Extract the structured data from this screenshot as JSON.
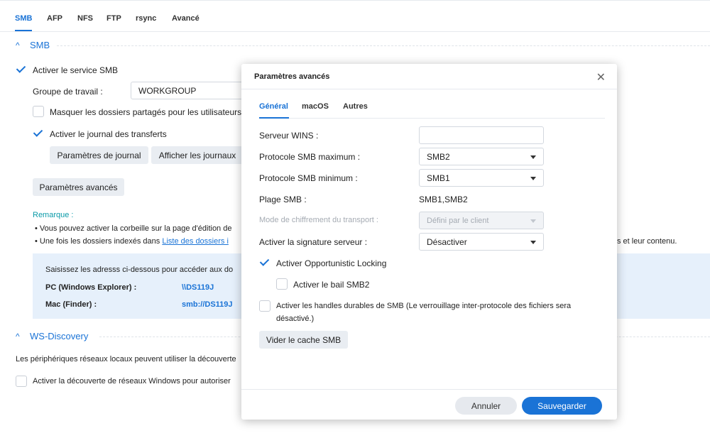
{
  "tabs": [
    {
      "label": "SMB",
      "active": true
    },
    {
      "label": "AFP"
    },
    {
      "label": "NFS"
    },
    {
      "label": "FTP"
    },
    {
      "label": "rsync"
    },
    {
      "label": "Avancé"
    }
  ],
  "smb_section": {
    "title": "SMB",
    "enable_label": "Activer le service SMB",
    "workgroup_label": "Groupe de travail :",
    "workgroup_value": "WORKGROUP",
    "hide_shares_label": "Masquer les dossiers partagés pour les utilisateurs ne",
    "transfer_log_label": "Activer le journal des transferts",
    "log_settings_button": "Paramètres de journal",
    "view_logs_button": "Afficher les journaux",
    "advanced_button": "Paramètres avancés",
    "note_title": "Remarque :",
    "note_1": "Vous pouvez activer la corbeille sur la page d'édition de",
    "note_2_prefix": "Une fois les dossiers indexés dans ",
    "note_2_link": "Liste des dossiers i",
    "note_2_tail": "s et leur contenu.",
    "info_intro": "Saisissez les adresss ci-dessous pour accéder aux do",
    "pc_label": "PC (Windows Explorer) :",
    "pc_value": "\\\\DS119J",
    "mac_label": "Mac (Finder) :",
    "mac_value": "smb://DS119J"
  },
  "ws_section": {
    "title": "WS-Discovery",
    "description": "Les périphériques réseaux locaux peuvent utiliser la découverte",
    "enable_label": "Activer la découverte de réseaux Windows pour autoriser"
  },
  "modal": {
    "title": "Paramètres avancés",
    "close_glyph": "✕",
    "tabs": [
      {
        "label": "Général",
        "active": true
      },
      {
        "label": "macOS"
      },
      {
        "label": "Autres"
      }
    ],
    "wins_label": "Serveur WINS :",
    "wins_value": "",
    "max_protocol_label": "Protocole SMB maximum :",
    "max_protocol_value": "SMB2",
    "min_protocol_label": "Protocole SMB minimum :",
    "min_protocol_value": "SMB1",
    "range_label": "Plage SMB :",
    "range_value": "SMB1,SMB2",
    "encryption_label": "Mode de chiffrement du transport :",
    "encryption_value": "Défini par le client",
    "signing_label": "Activer la signature serveur :",
    "signing_value": "Désactiver",
    "oplock_label": "Activer Opportunistic Locking",
    "lease_label": "Activer le bail SMB2",
    "durable_label_1": "Activer les handles durables de SMB (Le verrouillage inter-protocole des fichiers sera",
    "durable_label_2": "désactivé.)",
    "clear_cache_button": "Vider le cache SMB",
    "cancel_button": "Annuler",
    "save_button": "Sauvegarder"
  },
  "colors": {
    "accent": "#1a73d6",
    "note": "#0a9aa8",
    "info_bg": "#e6f0fb"
  }
}
